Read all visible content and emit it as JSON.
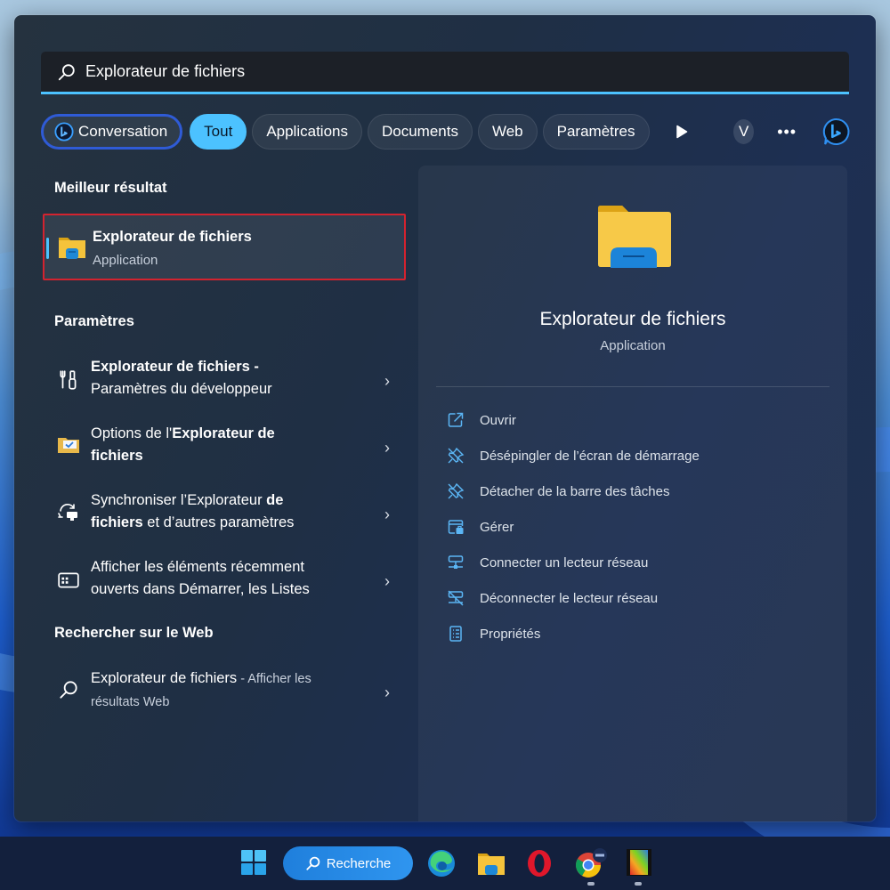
{
  "search": {
    "value": "Explorateur de fichiers",
    "placeholder": ""
  },
  "filters": {
    "conversation": "Conversation",
    "chips": [
      {
        "label": "Tout",
        "active": true
      },
      {
        "label": "Applications",
        "active": false
      },
      {
        "label": "Documents",
        "active": false
      },
      {
        "label": "Web",
        "active": false
      },
      {
        "label": "Paramètres",
        "active": false
      }
    ],
    "user_initial": "V",
    "more": "•••"
  },
  "best_match": {
    "section_title": "Meilleur résultat",
    "name": "Explorateur de fichiers",
    "type": "Application",
    "icon": "file-explorer-folder-icon"
  },
  "settings": {
    "section_title": "Paramètres",
    "items": [
      {
        "icon": "developer-tools-icon",
        "bold": "Explorateur de fichiers -",
        "text": "Paramètres du développeur"
      },
      {
        "icon": "folder-options-icon",
        "pre": "Options de l'",
        "bold": "Explorateur de",
        "bold2": "fichiers"
      },
      {
        "icon": "sync-icon",
        "pre": "Synchroniser l’Explorateur ",
        "bold": "de",
        "bold2": "fichiers",
        "post": " et d’autres paramètres"
      },
      {
        "icon": "start-list-icon",
        "line1": "Afficher les éléments récemment",
        "line2": "ouverts dans Démarrer, les Listes"
      }
    ]
  },
  "web": {
    "section_title": "Rechercher sur le Web",
    "query": "Explorateur de fichiers",
    "suffix": " - Afficher les",
    "suffix2": "résultats Web"
  },
  "preview": {
    "title": "Explorateur de fichiers",
    "subtitle": "Application",
    "actions": [
      {
        "icon": "open-icon",
        "label": "Ouvrir"
      },
      {
        "icon": "unpin-icon",
        "label": "Désépingler de l’écran de démarrage"
      },
      {
        "icon": "unpin-taskbar-icon",
        "label": "Détacher de la barre des tâches"
      },
      {
        "icon": "manage-icon",
        "label": "Gérer"
      },
      {
        "icon": "map-network-drive-icon",
        "label": "Connecter un lecteur réseau"
      },
      {
        "icon": "disconnect-network-drive-icon",
        "label": "Déconnecter le lecteur réseau"
      },
      {
        "icon": "properties-icon",
        "label": "Propriétés"
      }
    ]
  },
  "taskbar": {
    "search_label": "Recherche",
    "apps": [
      "start",
      "edge",
      "file-explorer",
      "opera",
      "chrome",
      "video-app"
    ]
  },
  "colors": {
    "accent": "#4cc2ff",
    "highlight_border": "#d3232f",
    "conversation_border": "#2f5bd6"
  }
}
